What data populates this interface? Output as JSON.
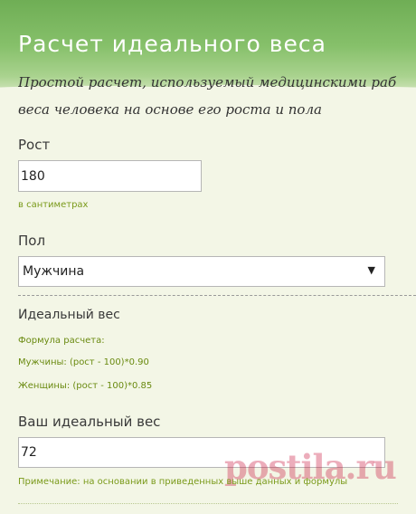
{
  "header": {
    "title": "Расчет идеального веса",
    "subtitle_line1": "Простой расчет, используемый медицинскими раб",
    "subtitle_line2": "веса человека на основе его роста и пола"
  },
  "height": {
    "label": "Рост",
    "value": "180",
    "hint": "в сантиметрах"
  },
  "sex": {
    "label": "Пол",
    "selected": "Мужчина"
  },
  "ideal": {
    "section_title": "Идеальный вес",
    "formula_title": "Формула расчета:",
    "formula_men": "Мужчины: (рост - 100)*0.90",
    "formula_women": "Женщины: (рост - 100)*0.85",
    "result_label": "Ваш идеальный вес",
    "result_value": "72",
    "note": "Примечание: на основании в приведенных выше данных и формулы"
  },
  "watermark": "postila.ru",
  "colors": {
    "header_green": "#86c06a",
    "hint_green": "#7a9a1a",
    "watermark": "#c8143c"
  }
}
